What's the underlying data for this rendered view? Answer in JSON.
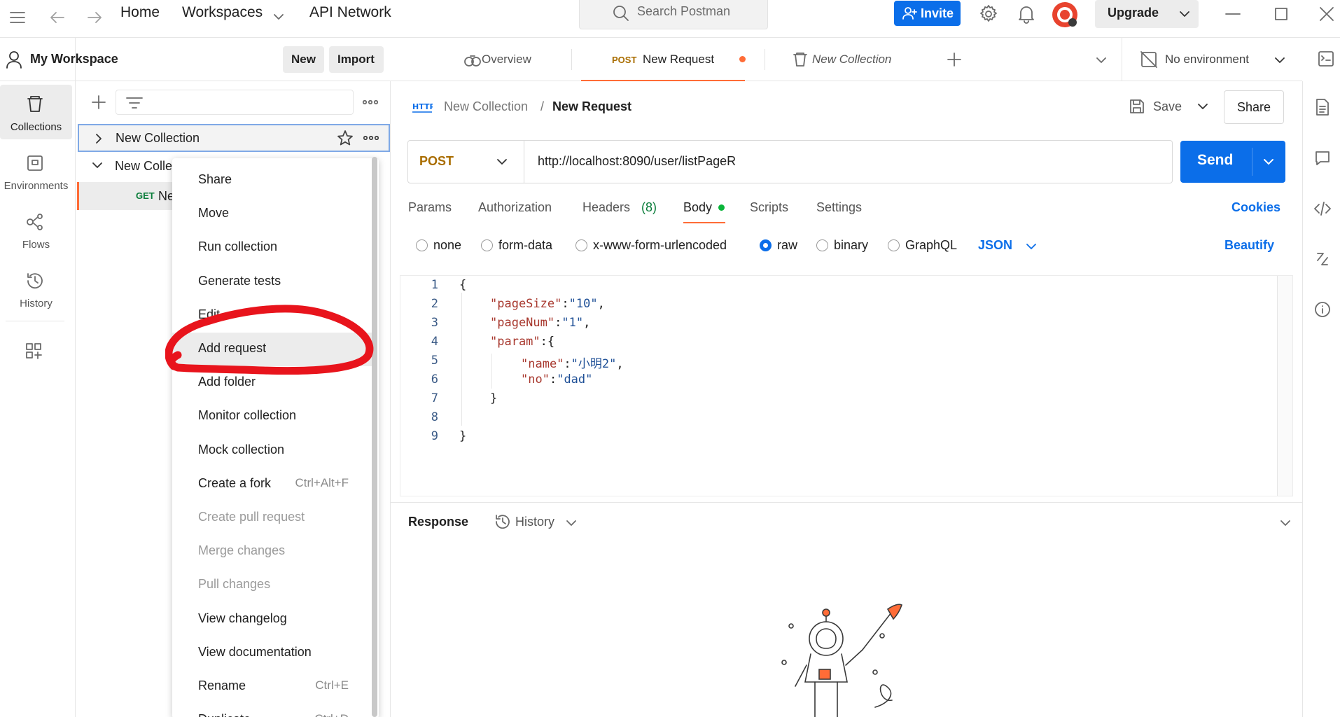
{
  "topbar": {
    "home": "Home",
    "workspaces": "Workspaces",
    "api_network": "API Network",
    "search_placeholder": "Search Postman",
    "invite": "Invite",
    "upgrade": "Upgrade"
  },
  "rail": {
    "collections": "Collections",
    "environments": "Environments",
    "flows": "Flows",
    "history": "History"
  },
  "workspace": {
    "name": "My Workspace",
    "new": "New",
    "import": "Import"
  },
  "tree": {
    "collection_1": "New Collection",
    "collection_2": "New Colle",
    "request_method": "GET",
    "request_name": "Ne"
  },
  "context_menu": [
    {
      "label": "Share",
      "shortcut": "",
      "disabled": false
    },
    {
      "label": "Move",
      "shortcut": "",
      "disabled": false
    },
    {
      "label": "Run collection",
      "shortcut": "",
      "disabled": false
    },
    {
      "label": "Generate tests",
      "shortcut": "",
      "disabled": false
    },
    {
      "label": "Edit",
      "shortcut": "",
      "disabled": false
    },
    {
      "label": "Add request",
      "shortcut": "",
      "disabled": false
    },
    {
      "label": "Add folder",
      "shortcut": "",
      "disabled": false
    },
    {
      "label": "Monitor collection",
      "shortcut": "",
      "disabled": false
    },
    {
      "label": "Mock collection",
      "shortcut": "",
      "disabled": false
    },
    {
      "label": "Create a fork",
      "shortcut": "Ctrl+Alt+F",
      "disabled": false
    },
    {
      "label": "Create pull request",
      "shortcut": "",
      "disabled": true
    },
    {
      "label": "Merge changes",
      "shortcut": "",
      "disabled": true
    },
    {
      "label": "Pull changes",
      "shortcut": "",
      "disabled": true
    },
    {
      "label": "View changelog",
      "shortcut": "",
      "disabled": false
    },
    {
      "label": "View documentation",
      "shortcut": "",
      "disabled": false
    },
    {
      "label": "Rename",
      "shortcut": "Ctrl+E",
      "disabled": false
    },
    {
      "label": "Duplicate",
      "shortcut": "Ctrl+D",
      "disabled": false
    }
  ],
  "tabs": {
    "overview": "Overview",
    "active_method": "POST",
    "active_name": "New Request",
    "collection": "New Collection",
    "environment": "No environment"
  },
  "request": {
    "breadcrumb_parent": "New Collection",
    "breadcrumb_sep": "/",
    "breadcrumb_current": "New Request",
    "save": "Save",
    "share": "Share",
    "method": "POST",
    "url": "http://localhost:8090/user/listPageR",
    "send": "Send",
    "tabs": [
      "Params",
      "Authorization",
      "Headers",
      "Body",
      "Scripts",
      "Settings"
    ],
    "headers_count": "(8)",
    "cookies": "Cookies",
    "body_types": [
      "none",
      "form-data",
      "x-www-form-urlencoded",
      "raw",
      "binary",
      "GraphQL"
    ],
    "body_format": "JSON",
    "beautify": "Beautify"
  },
  "code": {
    "line_numbers": [
      "1",
      "2",
      "3",
      "4",
      "5",
      "6",
      "7",
      "8",
      "9"
    ],
    "k_pagesize": "\"pageSize\"",
    "v_pagesize": "\"10\"",
    "k_pagenum": "\"pageNum\"",
    "v_pagenum": "\"1\"",
    "k_param": "\"param\"",
    "k_name": "\"name\"",
    "v_name": "\"小明2\"",
    "k_no": "\"no\"",
    "v_no": "\"dad\""
  },
  "response": {
    "label": "Response",
    "history": "History"
  },
  "colors": {
    "accent": "#0b6ee9",
    "postman_orange": "#ff6c37",
    "annotation": "#e8141c"
  }
}
